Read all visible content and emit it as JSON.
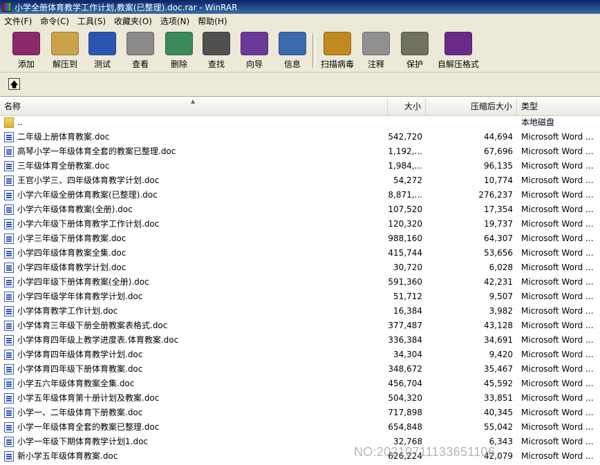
{
  "window": {
    "title": "小学全册体育教学工作计划,教案(已整理).doc.rar - WinRAR"
  },
  "menu": [
    "文件(F)",
    "命令(C)",
    "工具(S)",
    "收藏夹(O)",
    "选项(N)",
    "帮助(H)"
  ],
  "toolbar": [
    {
      "label": "添加",
      "icon": "add-archive-icon",
      "color": "#8a2a6a"
    },
    {
      "label": "解压到",
      "icon": "extract-to-icon",
      "color": "#c9a24a"
    },
    {
      "label": "测试",
      "icon": "test-icon",
      "color": "#2a55b0"
    },
    {
      "label": "查看",
      "icon": "view-icon",
      "color": "#8a8a8a"
    },
    {
      "label": "删除",
      "icon": "delete-icon",
      "color": "#3a8a5a"
    },
    {
      "label": "查找",
      "icon": "find-icon",
      "color": "#505050"
    },
    {
      "label": "向导",
      "icon": "wizard-icon",
      "color": "#6a3a9a"
    },
    {
      "label": "信息",
      "icon": "info-icon",
      "color": "#3a6ab0"
    },
    {
      "label": "扫描病毒",
      "icon": "virus-scan-icon",
      "color": "#c08a20"
    },
    {
      "label": "注释",
      "icon": "comment-icon",
      "color": "#909090"
    },
    {
      "label": "保护",
      "icon": "protect-icon",
      "color": "#707060"
    },
    {
      "label": "自解压格式",
      "icon": "sfx-icon",
      "color": "#6a2a8a"
    }
  ],
  "columns": {
    "name": "名称",
    "size": "大小",
    "packed": "压缩后大小",
    "type": "类型"
  },
  "updir": {
    "name": "..",
    "type": "本地磁盘"
  },
  "files": [
    {
      "name": "二年级上册体育教案.doc",
      "size": "542,720",
      "packed": "44,694",
      "type": "Microsoft Word ..."
    },
    {
      "name": "高琴小学一年级体育全套的教案已整理.doc",
      "size": "1,192,...",
      "packed": "67,696",
      "type": "Microsoft Word ..."
    },
    {
      "name": "三年级体育全册教案.doc",
      "size": "1,984,...",
      "packed": "96,135",
      "type": "Microsoft Word ..."
    },
    {
      "name": "王官小学三、四年级体育教学计划.doc",
      "size": "54,272",
      "packed": "10,774",
      "type": "Microsoft Word ..."
    },
    {
      "name": "小学六年级全册体育教案(已整理).doc",
      "size": "8,871,...",
      "packed": "276,237",
      "type": "Microsoft Word ..."
    },
    {
      "name": "小学六年级体育教案(全册).doc",
      "size": "107,520",
      "packed": "17,354",
      "type": "Microsoft Word ..."
    },
    {
      "name": "小学六年级下册体育教学工作计划.doc",
      "size": "120,320",
      "packed": "19,737",
      "type": "Microsoft Word ..."
    },
    {
      "name": "小学三年级下册体育教案.doc",
      "size": "988,160",
      "packed": "64,307",
      "type": "Microsoft Word ..."
    },
    {
      "name": "小学四年级体育教案全集.doc",
      "size": "415,744",
      "packed": "53,656",
      "type": "Microsoft Word ..."
    },
    {
      "name": "小学四年级体育教学计划.doc",
      "size": "30,720",
      "packed": "6,028",
      "type": "Microsoft Word ..."
    },
    {
      "name": "小学四年级下册体育教案(全册).doc",
      "size": "591,360",
      "packed": "42,231",
      "type": "Microsoft Word ..."
    },
    {
      "name": "小学四年级学年体育教学计划.doc",
      "size": "51,712",
      "packed": "9,507",
      "type": "Microsoft Word ..."
    },
    {
      "name": "小学体育教学工作计划.doc",
      "size": "16,384",
      "packed": "3,982",
      "type": "Microsoft Word ..."
    },
    {
      "name": "小学体育三年级下册全册教案表格式.doc",
      "size": "377,487",
      "packed": "43,128",
      "type": "Microsoft Word ..."
    },
    {
      "name": "小学体育四年级上教学进度表.体育教案.doc",
      "size": "336,384",
      "packed": "34,691",
      "type": "Microsoft Word ..."
    },
    {
      "name": "小学体育四年级体育教学计划.doc",
      "size": "34,304",
      "packed": "9,420",
      "type": "Microsoft Word ..."
    },
    {
      "name": "小学体育四年级下册体育教案.doc",
      "size": "348,672",
      "packed": "35,467",
      "type": "Microsoft Word ..."
    },
    {
      "name": "小学五六年级体育教案全集.doc",
      "size": "456,704",
      "packed": "45,592",
      "type": "Microsoft Word ..."
    },
    {
      "name": "小学五年级体育第十册计划及教案.doc",
      "size": "504,320",
      "packed": "33,851",
      "type": "Microsoft Word ..."
    },
    {
      "name": "小学一、二年级体育下册教案.doc",
      "size": "717,898",
      "packed": "40,345",
      "type": "Microsoft Word ..."
    },
    {
      "name": "小学一年级体育全套的教案已整理.doc",
      "size": "654,848",
      "packed": "55,042",
      "type": "Microsoft Word ..."
    },
    {
      "name": "小学一年级下期体育教学计划1.doc",
      "size": "32,768",
      "packed": "6,343",
      "type": "Microsoft Word ..."
    },
    {
      "name": "新小学五年级体育教案.doc",
      "size": "626,224",
      "packed": "42,079",
      "type": "Microsoft Word ..."
    }
  ],
  "watermark": "NO:20210711133651106"
}
